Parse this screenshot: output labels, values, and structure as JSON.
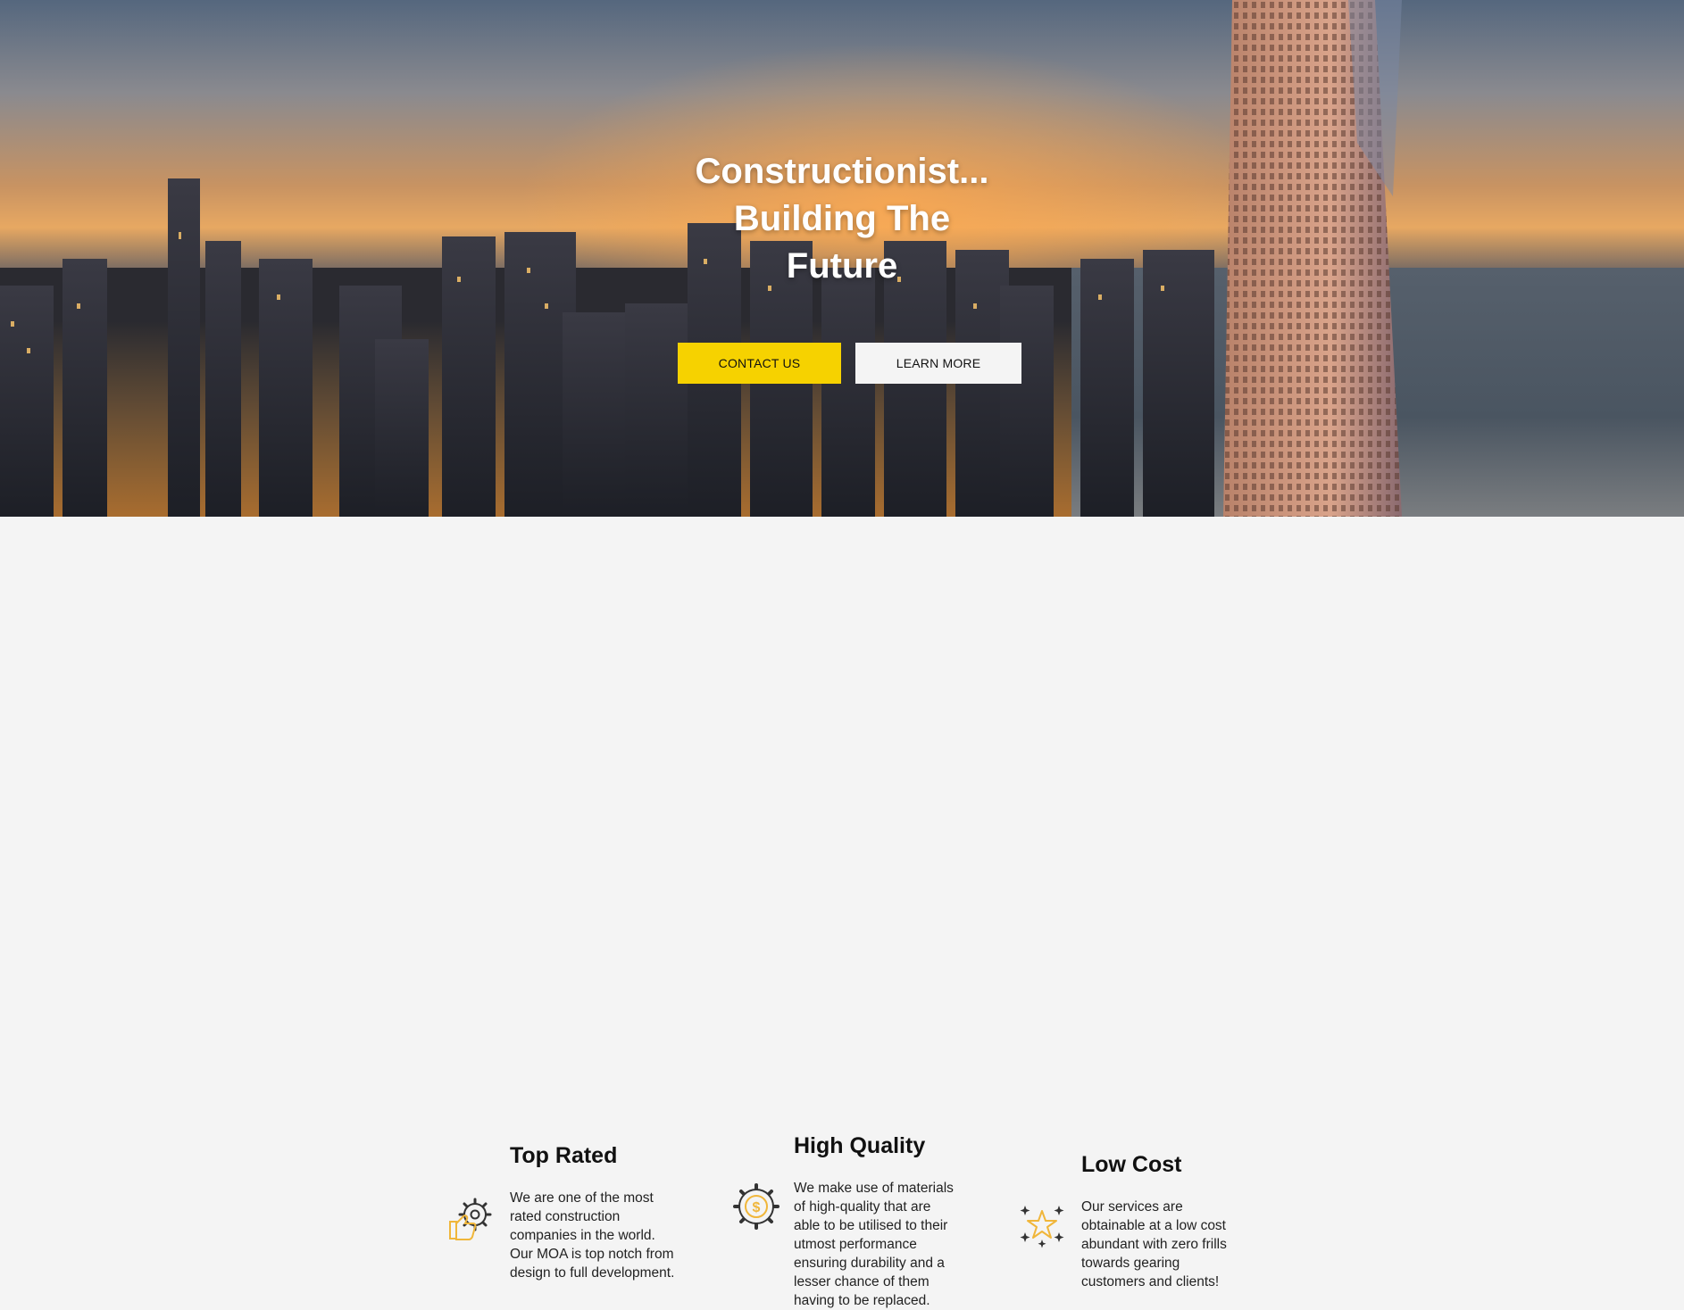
{
  "hero": {
    "title_line1": "Constructionist...",
    "title_line2": "Building The",
    "title_line3": "Future",
    "contact_label": "CONTACT US",
    "learn_label": "LEARN MORE"
  },
  "features": [
    {
      "title": "Top Rated",
      "text": "We are one of the most rated construction companies in the world. Our MOA is top notch from design to full development.",
      "icon": "gear-thumbs-up-icon"
    },
    {
      "title": "High Quality",
      "text": "We make use of materials of high-quality that are able to be utilised to their utmost performance ensuring durability and a lesser chance of them having to be replaced.",
      "icon": "gear-dollar-icon"
    },
    {
      "title": "Low Cost",
      "text": "Our services are obtainable at a low cost abundant with zero frills towards gearing customers and clients!",
      "icon": "stars-icon"
    }
  ],
  "colors": {
    "accent": "#f6d200",
    "icon_gold": "#f0b63a",
    "icon_dark": "#333333",
    "section_bg": "#f4f4f4"
  }
}
